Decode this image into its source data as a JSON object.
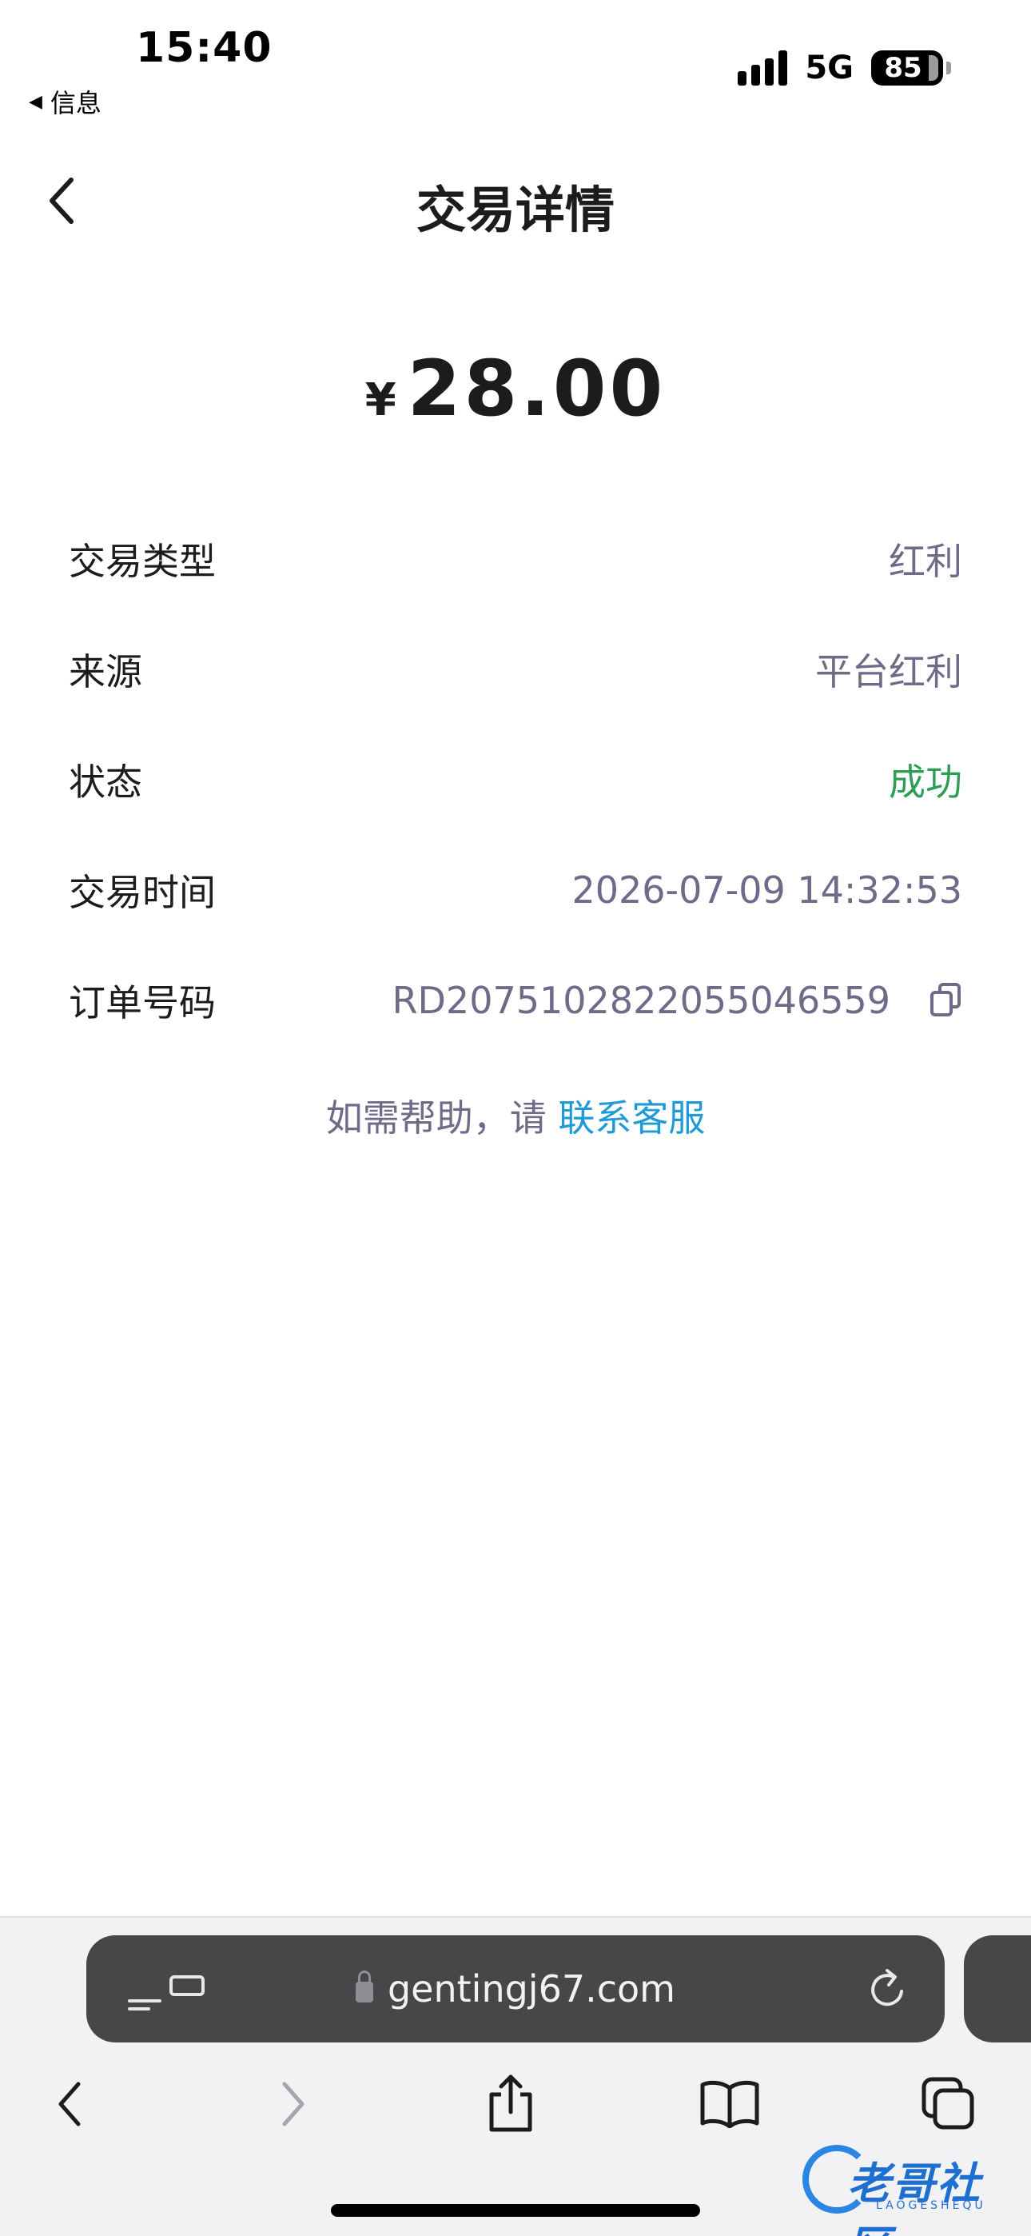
{
  "status_bar": {
    "time": "15:40",
    "back_app": "信息",
    "network": "5G",
    "battery": "85",
    "battery_level": 0.85
  },
  "header": {
    "title": "交易详情"
  },
  "amount": {
    "currency": "¥",
    "value": "28.00"
  },
  "details": [
    {
      "label": "交易类型",
      "value": "红利"
    },
    {
      "label": "来源",
      "value": "平台红利"
    },
    {
      "label": "状态",
      "value": "成功"
    },
    {
      "label": "交易时间",
      "value": "2026-07-09 14:32:53"
    },
    {
      "label": "订单号码",
      "value": "RD2075102822055046559"
    }
  ],
  "help": {
    "prefix": "如需帮助，请 ",
    "link": "联系客服"
  },
  "browser": {
    "url": "gentingj67.com"
  },
  "watermark": {
    "main": "老哥社区",
    "sub": "LAOGESHEQU"
  },
  "colors": {
    "success": "#2e9e55",
    "link": "#1e9ad6",
    "secondary_text": "#6e6b88"
  }
}
